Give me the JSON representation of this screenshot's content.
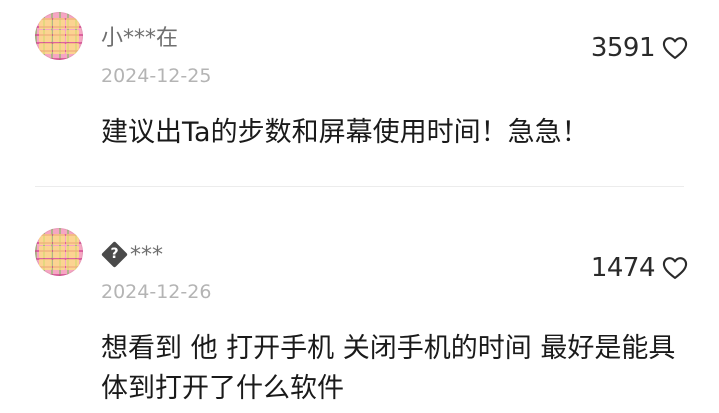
{
  "comments": [
    {
      "username": "小***在",
      "date": "2024-12-25",
      "likes": "3591",
      "text": "建议出Ta的步数和屏幕使用时间！急急！"
    },
    {
      "username": "***",
      "date": "2024-12-26",
      "likes": "1474",
      "text": "想看到 他 打开手机 关闭手机的时间 最好是能具体到打开了什么软件"
    }
  ],
  "icons": {
    "like": "heart-outline-icon",
    "unknown_char": "replacement-character-icon",
    "avatar": "avatar-pattern"
  },
  "colors": {
    "username": "#6f6f6f",
    "date": "#b4b4b4",
    "body": "#1a1a1a",
    "divider": "#ececec"
  }
}
